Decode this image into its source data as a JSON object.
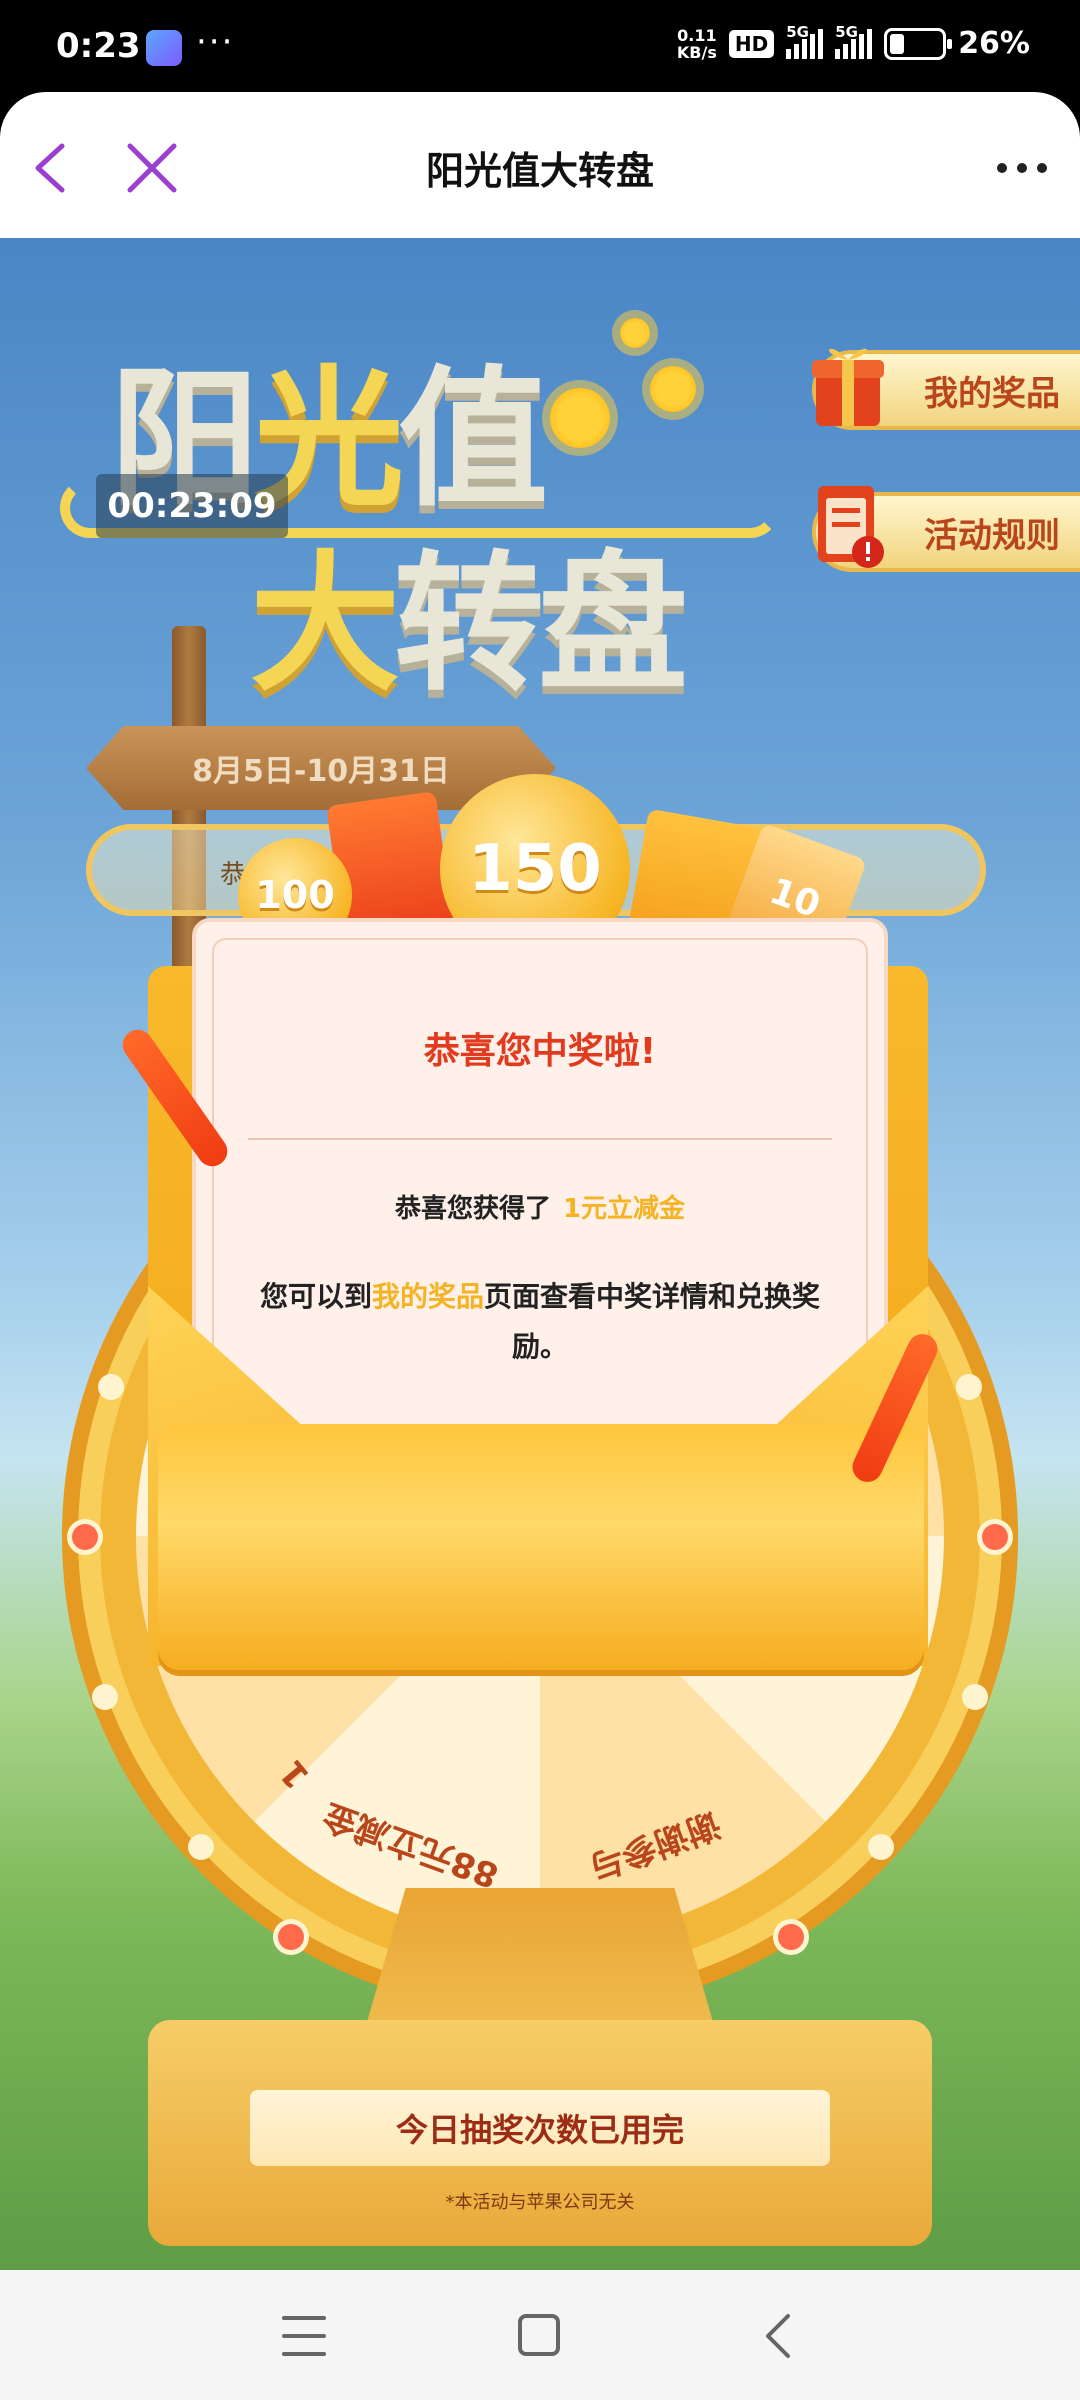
{
  "status_bar": {
    "time": "0:23",
    "more": "···",
    "net_speed_value": "0.11",
    "net_speed_unit": "KB/s",
    "hd_label": "HD",
    "network1": "5G",
    "network2": "5G",
    "battery": "26%",
    "battery_level": 0.26
  },
  "header": {
    "title": "阳光值大转盘"
  },
  "banner": {
    "title_line1_a": "阳",
    "title_line1_b": "光",
    "title_line1_c": "值",
    "title_line2_a": "大",
    "title_line2_b": "转盘",
    "timer": "00:23:09",
    "date_range": "8月5日-10月31日",
    "marquee_text": "恭"
  },
  "side_buttons": {
    "my_prizes": "我的奖品",
    "rules": "活动规则"
  },
  "wheel": {
    "slice_1": "88元立减金",
    "slice_2": "谢谢参与",
    "slice_3": "1"
  },
  "prizes": {
    "coin_small": "100",
    "coin_big": "150",
    "ticket": "10"
  },
  "modal": {
    "title": "恭喜您中奖啦!",
    "won_prefix": "恭喜您获得了",
    "won_prize": "1元立减金",
    "desc_prefix": "您可以到",
    "desc_link": "我的奖品",
    "desc_suffix": "页面查看中奖详情和兑换奖励。"
  },
  "footer": {
    "status_text": "今日抽奖次数已用完",
    "disclaimer": "*本活动与苹果公司无关"
  },
  "colors": {
    "accent_purple": "#9b3fd1",
    "modal_title_red": "#e23a1f",
    "highlight_yellow": "#f5b324",
    "sky_blue": "#4a86c6"
  },
  "icons": [
    "back-icon",
    "close-icon",
    "more-icon",
    "gift-icon",
    "rules-icon",
    "menu-icon",
    "home-icon",
    "nav-back-icon"
  ]
}
